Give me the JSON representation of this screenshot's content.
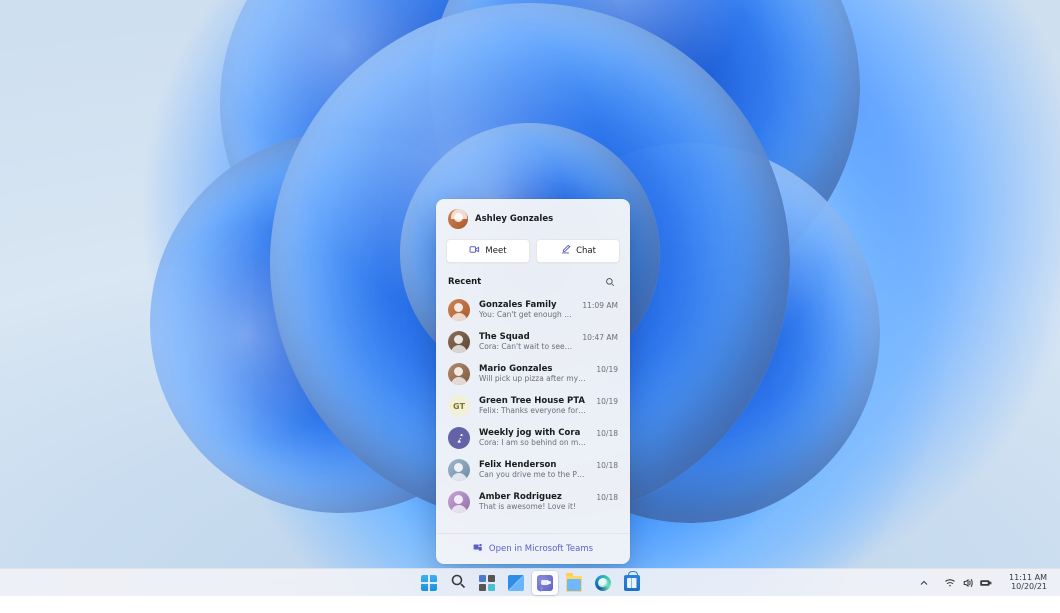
{
  "user": {
    "name": "Ashley Gonzales"
  },
  "actions": {
    "meet": "Meet",
    "chat": "Chat"
  },
  "recent": {
    "label": "Recent",
    "items": [
      {
        "title": "Gonzales Family",
        "subtitle": "You: Can't get enough of her.",
        "time": "11:09 AM",
        "avatar": "av-photo1 avface",
        "initials": ""
      },
      {
        "title": "The Squad",
        "subtitle": "Cora: Can't wait to see everyone!",
        "time": "10:47 AM",
        "avatar": "av-photo2 avface",
        "initials": ""
      },
      {
        "title": "Mario Gonzales",
        "subtitle": "Will pick up pizza after my practice.",
        "time": "10/19",
        "avatar": "av-photo3 avface",
        "initials": ""
      },
      {
        "title": "Green Tree House PTA",
        "subtitle": "Felix: Thanks everyone for attending today.",
        "time": "10/19",
        "avatar": "av-gt",
        "initials": "GT"
      },
      {
        "title": "Weekly jog with Cora",
        "subtitle": "Cora: I am so behind on my step goals.",
        "time": "10/18",
        "avatar": "av-jog",
        "initials": ""
      },
      {
        "title": "Felix Henderson",
        "subtitle": "Can you drive me to the PTA today?",
        "time": "10/18",
        "avatar": "av-felix avface",
        "initials": ""
      },
      {
        "title": "Amber Rodriguez",
        "subtitle": "That is awesome! Love it!",
        "time": "10/18",
        "avatar": "av-amber avface",
        "initials": ""
      }
    ]
  },
  "footer": {
    "open_teams": "Open in Microsoft Teams"
  },
  "taskbar": {
    "items": [
      {
        "name": "start-button",
        "icon": "start"
      },
      {
        "name": "search-button",
        "icon": "search"
      },
      {
        "name": "taskview-button",
        "icon": "taskview"
      },
      {
        "name": "widgets-button",
        "icon": "widgets"
      },
      {
        "name": "chat-button",
        "icon": "chat",
        "active": true
      },
      {
        "name": "file-explorer-button",
        "icon": "explorer"
      },
      {
        "name": "edge-button",
        "icon": "edge"
      },
      {
        "name": "store-button",
        "icon": "store"
      }
    ]
  },
  "tray": {
    "time": "11:11 AM",
    "date": "10/20/21"
  }
}
